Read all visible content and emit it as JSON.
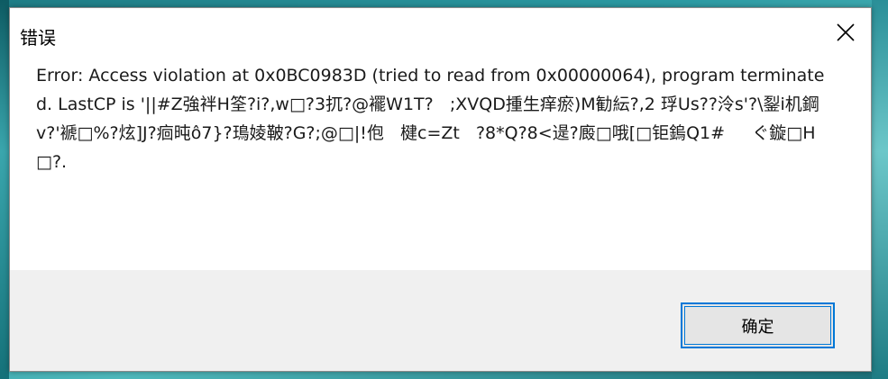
{
  "dialog": {
    "title": "错误",
    "close_icon": "close-icon",
    "message": "Error: Access violation at 0x0BC0983D (tried to read from 0x00000064), program terminated. LastCP is '||#Z強袢H筌?i?,w□?3扤?@襬W1T?   ;XVQD揰生痒瘀)M勧紜?,2 琈Us??泠s'?\\銐i机鋼v?'褫□%?炫]J?痐旽ô7}?鳿婈鞁?G?;@□|!佨   楗c=Zt   ?8*Q?8<遈?廄□哦[□钜鎢Q1#     ぐ鏇□H□?.",
    "ok_label": "确定"
  },
  "colors": {
    "accent": "#0078d7",
    "footer_bg": "#f0f0f0",
    "button_bg": "#e5e5e5"
  }
}
